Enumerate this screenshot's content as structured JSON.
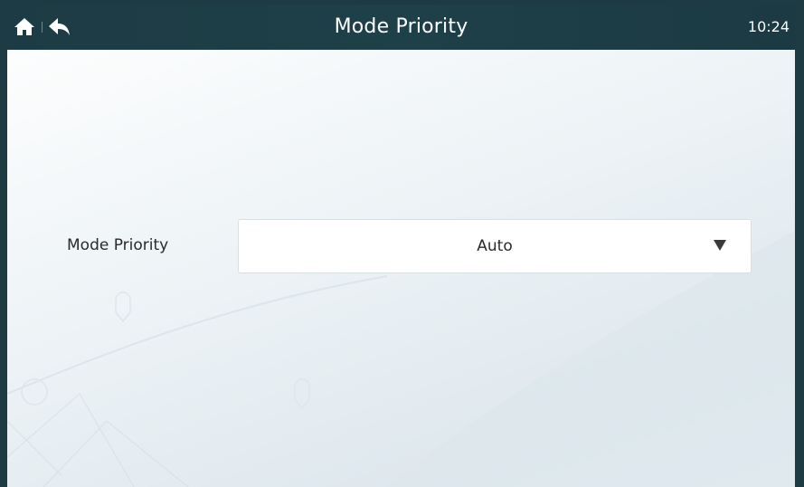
{
  "header": {
    "title": "Mode Priority",
    "time": "10:24",
    "home_icon": "home-icon",
    "back_icon": "back-arrow-icon"
  },
  "form": {
    "label": "Mode Priority",
    "selected_value": "Auto",
    "arrow_icon": "dropdown-triangle-icon"
  },
  "colors": {
    "header_bg": "#1d3b44",
    "header_text": "#ffffff",
    "body_text": "#2a2a2a",
    "dropdown_bg": "#ffffff"
  }
}
